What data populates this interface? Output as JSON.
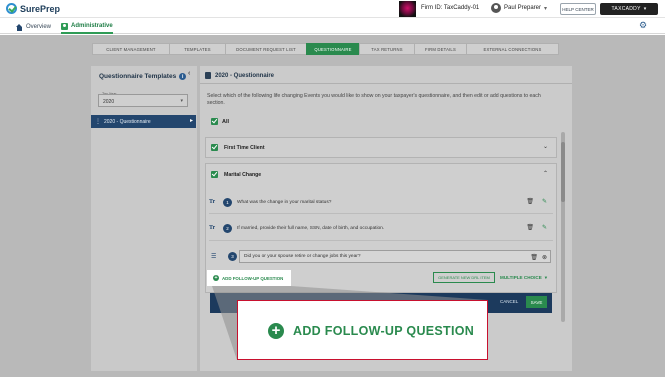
{
  "topbar": {
    "logo_text": "SurePrep",
    "firm_id": "Firm ID: TaxCaddy-01",
    "user_name": "Paul Preparer",
    "help_center": "HELP CENTER",
    "taxcaddy": "TAXCADDY"
  },
  "nav": {
    "overview": "Overview",
    "administrative": "Administrative"
  },
  "subtabs": [
    "CLIENT MANAGEMENT",
    "TEMPLATES",
    "DOCUMENT REQUEST LIST",
    "QUESTIONNAIRE",
    "TAX RETURNS",
    "FIRM DETAILS",
    "EXTERNAL CONNECTIONS"
  ],
  "left_panel": {
    "title": "Questionnaire Templates",
    "tax_year_label": "Tax Year",
    "tax_year": "2020",
    "item": "2020 - Questionnaire"
  },
  "right_panel": {
    "title": "2020 - Questionnaire",
    "description": "Select which of the following life changing Events you would like to show on your taxpayer's questionnaire, and then edit or add questions to each section.",
    "all_label": "All",
    "events": [
      {
        "label": "First Time Client"
      },
      {
        "label": "Marital Change"
      }
    ],
    "questions": [
      {
        "type_icon": "Tr",
        "number": "1",
        "text": "What was the change in your marital status?"
      },
      {
        "type_icon": "Tr",
        "number": "2",
        "text": "If married, provide their full name, SSN, date of birth, and occupation."
      }
    ],
    "editing_question": {
      "type_icon": "☰",
      "number": "3",
      "text": "Did you or your spouse retire or change jobs this year?"
    },
    "add_followup": "ADD FOLLOW-UP QUESTION",
    "generate_btn": "GENERATE NEW DRL ITEM",
    "question_type": "MULTIPLE CHOICE",
    "cancel": "CANCEL",
    "save": "SAVE"
  },
  "callout": {
    "label": "ADD FOLLOW-UP QUESTION"
  },
  "colors": {
    "brand_green": "#2a8a4e",
    "navy": "#23466e",
    "highlight_red": "#c8102e"
  }
}
